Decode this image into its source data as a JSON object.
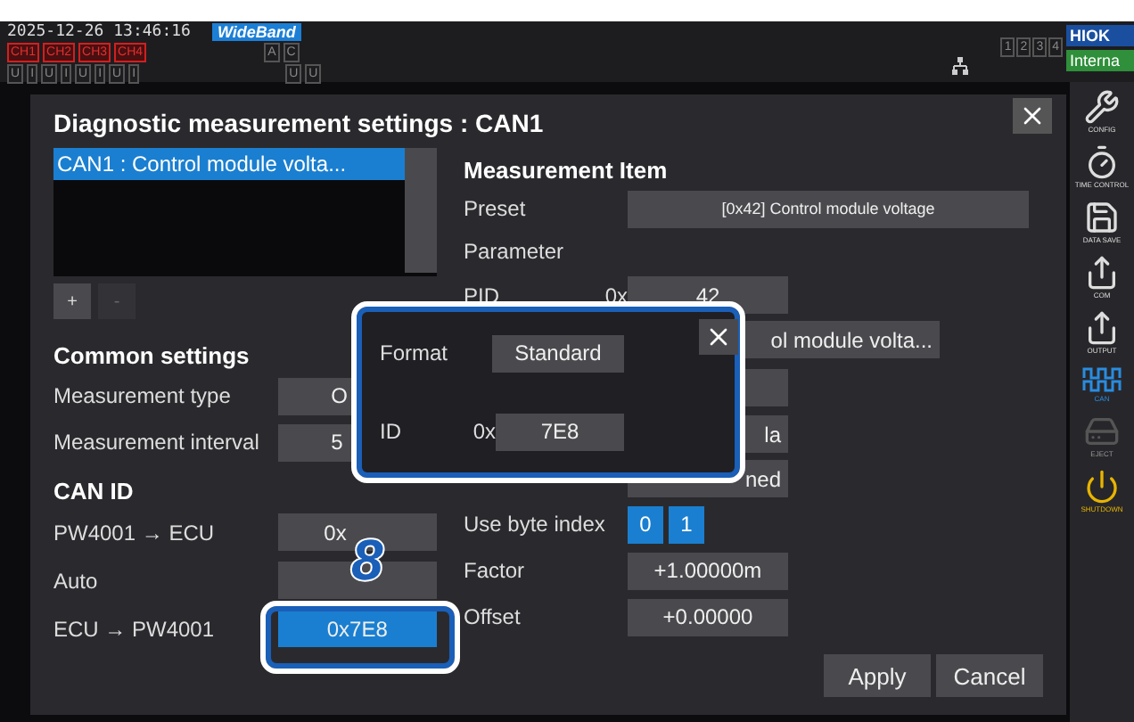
{
  "status_bar": {
    "datetime": "2025-12-26 13:46:16",
    "mode": "WideBand",
    "channels": [
      {
        "label": "CH1",
        "active": true
      },
      {
        "label": "CH2",
        "active": true
      },
      {
        "label": "CH3",
        "active": true
      },
      {
        "label": "CH4",
        "active": true
      }
    ],
    "channel_units": [
      "U",
      "I",
      "U",
      "I",
      "U",
      "I",
      "U",
      "I"
    ],
    "wiring": [
      "A",
      "C"
    ],
    "wiring_units": [
      "U",
      "U"
    ],
    "pages": [
      "1",
      "2",
      "3",
      "4"
    ]
  },
  "brand": {
    "logo": "HIOK",
    "source": "Interna"
  },
  "sidebar": {
    "items": [
      {
        "label": "CONFIG",
        "selected": false,
        "disabled": false
      },
      {
        "label": "TIME CONTROL",
        "selected": false,
        "disabled": false
      },
      {
        "label": "DATA SAVE",
        "selected": false,
        "disabled": false
      },
      {
        "label": "COM",
        "selected": false,
        "disabled": false
      },
      {
        "label": "OUTPUT",
        "selected": false,
        "disabled": false
      },
      {
        "label": "CAN",
        "selected": true,
        "disabled": false
      },
      {
        "label": "EJECT",
        "selected": false,
        "disabled": true
      },
      {
        "label": "SHUTDOWN",
        "selected": false,
        "disabled": false
      }
    ]
  },
  "dialog": {
    "title": "Diagnostic measurement settings : CAN1",
    "list": {
      "items": [
        {
          "label": "CAN1 : Control module volta...",
          "selected": true
        }
      ]
    },
    "list_buttons": [
      {
        "label": "+",
        "disabled": false
      },
      {
        "label": "-",
        "disabled": true
      }
    ],
    "common_settings": {
      "title": "Common settings",
      "rows": [
        {
          "label": "Measurement type",
          "value": "O"
        },
        {
          "label": "Measurement interval",
          "value": "5"
        }
      ]
    },
    "can_id": {
      "title": "CAN ID",
      "rows": [
        {
          "label": "PW4001 → ECU",
          "value": "0x",
          "selected": false
        },
        {
          "label": "Auto",
          "selected": false
        },
        {
          "label": "ECU → PW4001",
          "value": "0x7E8",
          "selected": true
        }
      ]
    },
    "measurement_item": {
      "title": "Measurement Item",
      "preset": {
        "label": "Preset",
        "value": "[0x42] Control module voltage"
      },
      "parameter_title": "Parameter",
      "rows": [
        {
          "label": "PID",
          "prefix": "0x",
          "value": "42"
        },
        {
          "value": "ol module volta..."
        },
        {},
        {
          "value": "la"
        },
        {
          "value": "ned"
        }
      ],
      "byte_index": {
        "label": "Use byte index",
        "options": [
          {
            "label": "0",
            "selected": true
          },
          {
            "label": "1",
            "selected": true
          }
        ]
      },
      "factor": {
        "label": "Factor",
        "value": "+1.00000m"
      },
      "offset": {
        "label": "Offset",
        "value": "+0.00000"
      }
    },
    "buttons": [
      "Apply",
      "Cancel"
    ]
  },
  "popup": {
    "format": {
      "label": "Format",
      "value": "Standard"
    },
    "id": {
      "label": "ID",
      "prefix": "0x",
      "value": "7E8"
    }
  },
  "callout": {
    "number": "8"
  }
}
